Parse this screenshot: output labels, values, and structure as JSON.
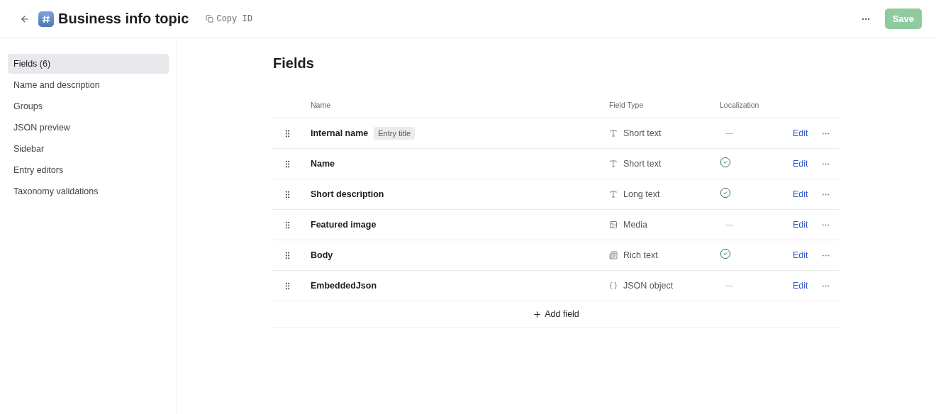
{
  "header": {
    "title": "Business info topic",
    "copy_id": "Copy ID",
    "save": {
      "label": "Save",
      "disabled": true
    }
  },
  "sidebar": {
    "items": [
      {
        "label": "Fields (6)",
        "selected": true
      },
      {
        "label": "Name and description",
        "selected": false
      },
      {
        "label": "Groups",
        "selected": false
      },
      {
        "label": "JSON preview",
        "selected": false
      },
      {
        "label": "Sidebar",
        "selected": false
      },
      {
        "label": "Entry editors",
        "selected": false
      },
      {
        "label": "Taxonomy validations",
        "selected": false
      }
    ]
  },
  "main": {
    "heading": "Fields",
    "table": {
      "columns": [
        "Name",
        "Field Type",
        "Localization"
      ],
      "rows": [
        {
          "name": "Internal name",
          "badge": "Entry title",
          "kind": "text",
          "type": "Short text",
          "localized": false,
          "action": "Edit"
        },
        {
          "name": "Name",
          "kind": "text",
          "type": "Short text",
          "localized": true,
          "action": "Edit"
        },
        {
          "name": "Short description",
          "kind": "text",
          "type": "Long text",
          "localized": true,
          "action": "Edit"
        },
        {
          "name": "Featured image",
          "kind": "media",
          "type": "Media",
          "localized": false,
          "action": "Edit"
        },
        {
          "name": "Body",
          "kind": "richtext",
          "type": "Rich text",
          "localized": true,
          "action": "Edit"
        },
        {
          "name": "EmbeddedJson",
          "kind": "json",
          "type": "JSON object",
          "localized": false,
          "action": "Edit"
        }
      ]
    },
    "add_field": "Add field"
  }
}
